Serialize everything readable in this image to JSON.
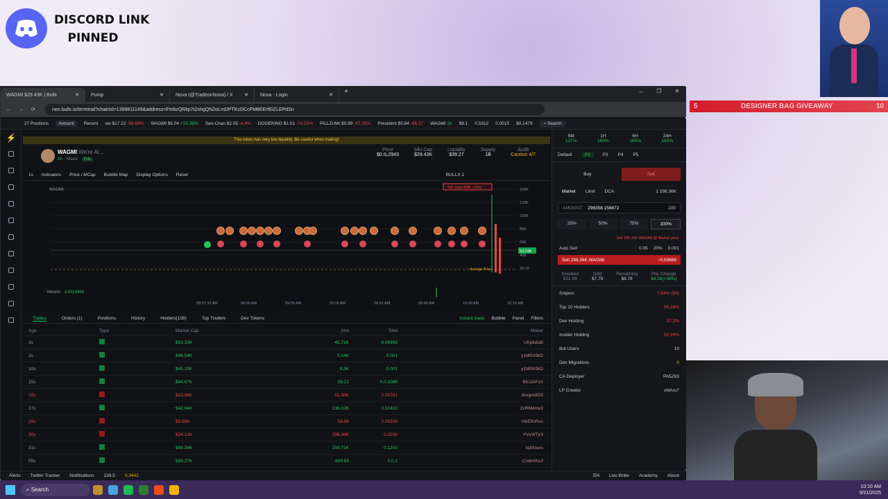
{
  "overlay": {
    "discord_text": "DISCORD LINK\nPINNED",
    "banner_left": "5",
    "banner_text": "DESIGNER BAG GIVEAWAY",
    "banner_right": "10"
  },
  "tabs": [
    {
      "label": "WAGMI $29.43K | Bullx"
    },
    {
      "label": "Pump"
    },
    {
      "label": "Nova (@TradeonNova) / X"
    },
    {
      "label": "Nova - Login"
    }
  ],
  "url": "neo.bullx.io/terminal?chainId=1399811149&address=FmbzQRkp7t2xhgQN2oLmDPTKcDCcPM8EErfEiZLEPdSn",
  "ticker": {
    "positions": "27 Positions",
    "amount": "Amount",
    "recent": "Recent",
    "items": [
      {
        "name": "ow $17.22",
        "chg": "-58.68%",
        "up": false
      },
      {
        "name": "WAGMI $6.04",
        "chg": "+15.36%",
        "up": true
      },
      {
        "name": "San-Chan $2.05",
        "chg": "-4.6%",
        "up": false
      },
      {
        "name": "DOGEKING $1.01",
        "chg": "-74.53%",
        "up": false
      },
      {
        "name": "PILLZUMI $0.99",
        "chg": "-97.35%",
        "up": false
      },
      {
        "name": "President $0.84",
        "chg": "-96.37",
        "up": false
      },
      {
        "name": "WAGMI",
        "chg": "2h",
        "up": true
      },
      {
        "name": "$8.1",
        "chg": "",
        "up": true
      }
    ],
    "stats": [
      "0.5312",
      "0.0015",
      "$0.1479"
    ],
    "search": "Search"
  },
  "warning": "This token has very low liquidity. Be careful when trading!",
  "token": {
    "name": "WAGMI",
    "tagline": "We're Al...",
    "age": "2h",
    "share": "Share",
    "pnl": "PnL",
    "stats": [
      {
        "label": "Price",
        "value": "$0.0₅2943"
      },
      {
        "label": "Mkt Cap",
        "value": "$29.43K"
      },
      {
        "label": "Liquidity",
        "value": "$39.27"
      },
      {
        "label": "Supply",
        "value": "1B"
      },
      {
        "label": "Audit",
        "value": "Caution 4/7"
      }
    ]
  },
  "charttools": {
    "interval": "1s",
    "indicators": "Indicators",
    "price_mcap": "Price / MCap",
    "bubble": "Bubble Map",
    "display": "Display Options",
    "reset": "Reset",
    "source": "BULLX-1"
  },
  "chart": {
    "label": "WAGMI",
    "volume_label": "Volume",
    "volume": "2.6314456",
    "y_ticks": [
      "150K",
      "120K",
      "100K",
      "80K",
      "60K",
      "40K",
      "20.1K"
    ],
    "x_ticks": [
      "08:37:32 AM",
      "09:00 AM",
      "09:05 AM",
      "09:15 AM",
      "09:31 AM",
      "09:46 AM",
      "10:00 AM",
      "10:10 AM"
    ],
    "sell_tag": "Sell close $78K | 26%",
    "avg_tag": "Average Price",
    "price_tag": "53.23K"
  },
  "tradetabs": [
    "Trades",
    "Orders (1)",
    "Positions",
    "History",
    "Holders(108)",
    "Top Traders",
    "Dev Tokens"
  ],
  "tradetools": [
    "Instant trade",
    "Bubble",
    "Panel",
    "Filters"
  ],
  "table": {
    "headers": [
      "Age",
      "Type",
      "Market Cap",
      "Amt",
      "Total",
      "Maker"
    ],
    "rows": [
      {
        "age": "2s",
        "buy": true,
        "mc": "$53.33K",
        "amt": "45.71K",
        "total": "0.08999",
        "maker": "UKpkds8t"
      },
      {
        "age": "2s",
        "buy": true,
        "mc": "$46.54K",
        "amt": "5.14K",
        "total": "0.001",
        "maker": "y1M5X9kD"
      },
      {
        "age": "10s",
        "buy": true,
        "mc": "$45.19K",
        "amt": "8.3K",
        "total": "0.001",
        "maker": "y1M5X9kD"
      },
      {
        "age": "15s",
        "buy": true,
        "mc": "$44.67K",
        "amt": "58.22",
        "total": "0.0.1086",
        "maker": "BE1iAFsS"
      },
      {
        "age": "19s",
        "buy": false,
        "mc": "$13.96K",
        "amt": "51.38K",
        "total": "0.00781",
        "maker": "dvxgm8G9"
      },
      {
        "age": "27s",
        "buy": true,
        "mc": "$42.84K",
        "amt": "136.02K",
        "total": "0.02432",
        "maker": "2vR6Mme3"
      },
      {
        "age": "29s",
        "buy": false,
        "mc": "$9.69K",
        "amt": "58.96",
        "total": "0.00236",
        "maker": "mkEfmRxs"
      },
      {
        "age": "30s",
        "buy": false,
        "mc": "$24.12K",
        "amt": "298.36K",
        "total": "0.0236",
        "maker": "YVsWTjr3"
      },
      {
        "age": "31s",
        "buy": true,
        "mc": "$99.26K",
        "amt": "299.71K",
        "total": "0.1242",
        "maker": "Iq3Xrexs"
      },
      {
        "age": "55s",
        "buy": true,
        "mc": "$39.27K",
        "amt": "609.83",
        "total": "0.0.1",
        "maker": "CmkmKo3"
      }
    ]
  },
  "right": {
    "timeframes": [
      {
        "l": "5M",
        "v": "137%"
      },
      {
        "l": "1H",
        "v": "160%"
      },
      {
        "l": "6H",
        "v": "165%"
      },
      {
        "l": "24H",
        "v": "165%"
      }
    ],
    "presets": [
      "Default",
      "P2",
      "P3",
      "P4",
      "P5"
    ],
    "buy": "Buy",
    "sell": "Sell",
    "ordertypes": [
      "Market",
      "Limit",
      "DCA"
    ],
    "balance": "1 298.36K",
    "amount_label": "AMOUNT",
    "amount": "298358.156872",
    "amount_pct": "100",
    "pcts": [
      "25%",
      "50%",
      "75%",
      "100%"
    ],
    "sell_hint": "Sell 298.36K WAGMI @ Market price",
    "autosell": "Auto Sell",
    "fees": [
      "0.05",
      "20%",
      "0.001"
    ],
    "sell_btn": "Sell 298.36K WAGMI",
    "sell_btn_val": "~0.03666",
    "pos": [
      {
        "l": "Invested",
        "v": "$11.99"
      },
      {
        "l": "Sold",
        "v": "$7.79"
      },
      {
        "l": "Remaining",
        "v": "$8.78"
      },
      {
        "l": "PnL Change",
        "v": "$4.58(+38%)"
      }
    ],
    "stats": [
      {
        "l": "Snipers",
        "v": "7.64% (50)"
      },
      {
        "l": "Top 10 Holders",
        "v": "95.39%"
      },
      {
        "l": "Dev Holding",
        "v": "37.2%"
      },
      {
        "l": "Insider Holding",
        "v": "52.99%"
      },
      {
        "l": "Bot Users",
        "v": "10"
      },
      {
        "l": "Dev Migrations",
        "v": "0"
      },
      {
        "l": "CA Deployer",
        "v": "PA5Z63"
      },
      {
        "l": "LP Creator",
        "v": "oNAru7"
      }
    ]
  },
  "status": {
    "alerts": "Alerts",
    "twitter": "Twitter Tracker",
    "notifs": "Notifications",
    "sol": "239.5",
    "bal": "0.3442",
    "lang": "EN",
    "live": "Live Bribe",
    "academy": "Academy",
    "about": "About"
  },
  "taskbar": {
    "search": "Search",
    "time": "10:10 AM",
    "date": "9/21/2025"
  }
}
